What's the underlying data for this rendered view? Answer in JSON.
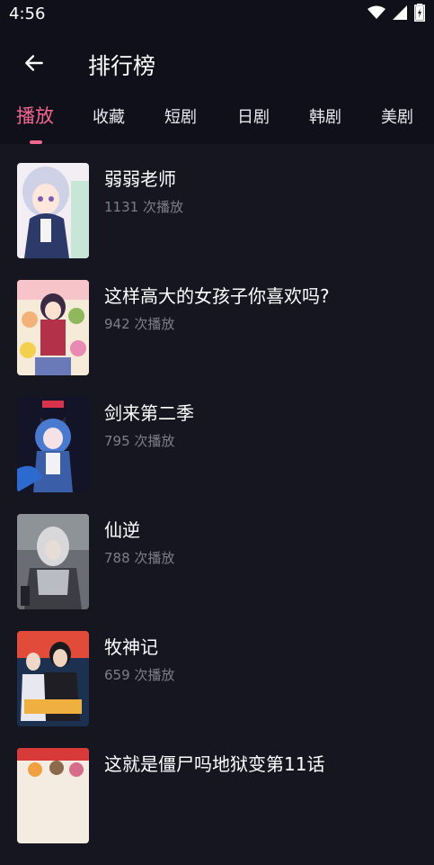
{
  "status_bar": {
    "time": "4:56"
  },
  "header": {
    "title": "排行榜"
  },
  "tabs": [
    {
      "label": "播放",
      "active": true
    },
    {
      "label": "收藏",
      "active": false
    },
    {
      "label": "短剧",
      "active": false
    },
    {
      "label": "日剧",
      "active": false
    },
    {
      "label": "韩剧",
      "active": false
    },
    {
      "label": "美剧",
      "active": false
    }
  ],
  "colors": {
    "accent": "#f2668f",
    "background": "#161620",
    "header_bg": "#10101a",
    "muted_text": "#7e7e8a"
  },
  "items": [
    {
      "title": "弱弱老师",
      "plays": "1131 次播放"
    },
    {
      "title": "这样高大的女孩子你喜欢吗?",
      "plays": "942 次播放"
    },
    {
      "title": "剑来第二季",
      "plays": "795 次播放"
    },
    {
      "title": "仙逆",
      "plays": "788 次播放"
    },
    {
      "title": "牧神记",
      "plays": "659 次播放"
    },
    {
      "title": "这就是僵尸吗地狱变第11话",
      "plays": ""
    }
  ]
}
